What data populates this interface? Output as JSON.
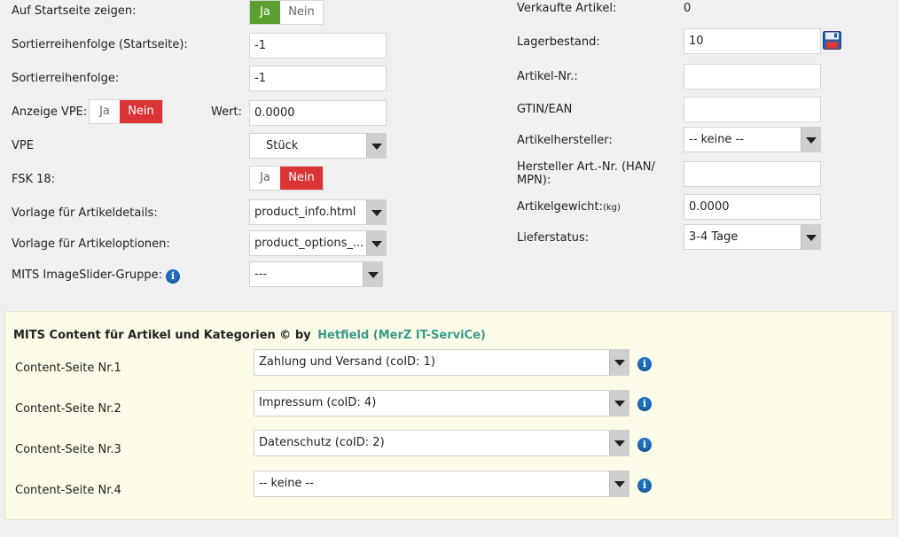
{
  "left": {
    "startseite": {
      "label": "Auf Startseite zeigen:",
      "yes": "Ja",
      "no": "Nein"
    },
    "sort_start": {
      "label": "Sortierreihenfolge (Startseite):",
      "value": "-1"
    },
    "sort": {
      "label": "Sortierreihenfolge:",
      "value": "-1"
    },
    "vpe_show": {
      "label": "Anzeige VPE:",
      "yes": "Ja",
      "no": "Nein"
    },
    "wert": {
      "label": "Wert:",
      "value": "0.0000"
    },
    "vpe": {
      "label": "VPE",
      "value": "Stück"
    },
    "fsk": {
      "label": "FSK 18:",
      "yes": "Ja",
      "no": "Nein"
    },
    "tpl_details": {
      "label": "Vorlage für Artikeldetails:",
      "value": "product_info.html"
    },
    "tpl_options": {
      "label": "Vorlage für Artikeloptionen:",
      "value": "product_options_..."
    },
    "imageslider": {
      "label": "MITS ImageSlider-Gruppe:",
      "value": "---"
    }
  },
  "right": {
    "sold": {
      "label": "Verkaufte Artikel:",
      "value": "0"
    },
    "stock": {
      "label": "Lagerbestand:",
      "value": "10"
    },
    "artnr": {
      "label": "Artikel-Nr.:",
      "value": ""
    },
    "gtin": {
      "label": "GTIN/EAN",
      "value": ""
    },
    "manufacturer": {
      "label": "Artikelhersteller:",
      "value": "-- keine --"
    },
    "han_line1": "Hersteller Art.-Nr. (HAN/",
    "han_line2": "MPN):",
    "han_value": "",
    "weight": {
      "label": "Artikelgewicht:",
      "unit": "(kg)",
      "value": "0.0000"
    },
    "delivery": {
      "label": "Lieferstatus:",
      "value": "3-4 Tage"
    }
  },
  "mits": {
    "title": "MITS Content für Artikel und Kategorien © by",
    "author": "Hetfield (MerZ IT-ServiCe)",
    "rows": [
      {
        "label": "Content-Seite Nr.1",
        "value": "Zahlung und Versand (coID: 1)"
      },
      {
        "label": "Content-Seite Nr.2",
        "value": "Impressum (coID: 4)"
      },
      {
        "label": "Content-Seite Nr.3",
        "value": "Datenschutz (coID: 2)"
      },
      {
        "label": "Content-Seite Nr.4",
        "value": "-- keine --"
      }
    ]
  },
  "colors": {
    "green": "#5c9e2f",
    "red": "#db3434",
    "link": "#3a9a8a",
    "info": "#1f6fbf"
  },
  "icons": {
    "info": "info-icon",
    "save": "floppy-disk-icon",
    "dropdown": "triangle-down-icon"
  }
}
